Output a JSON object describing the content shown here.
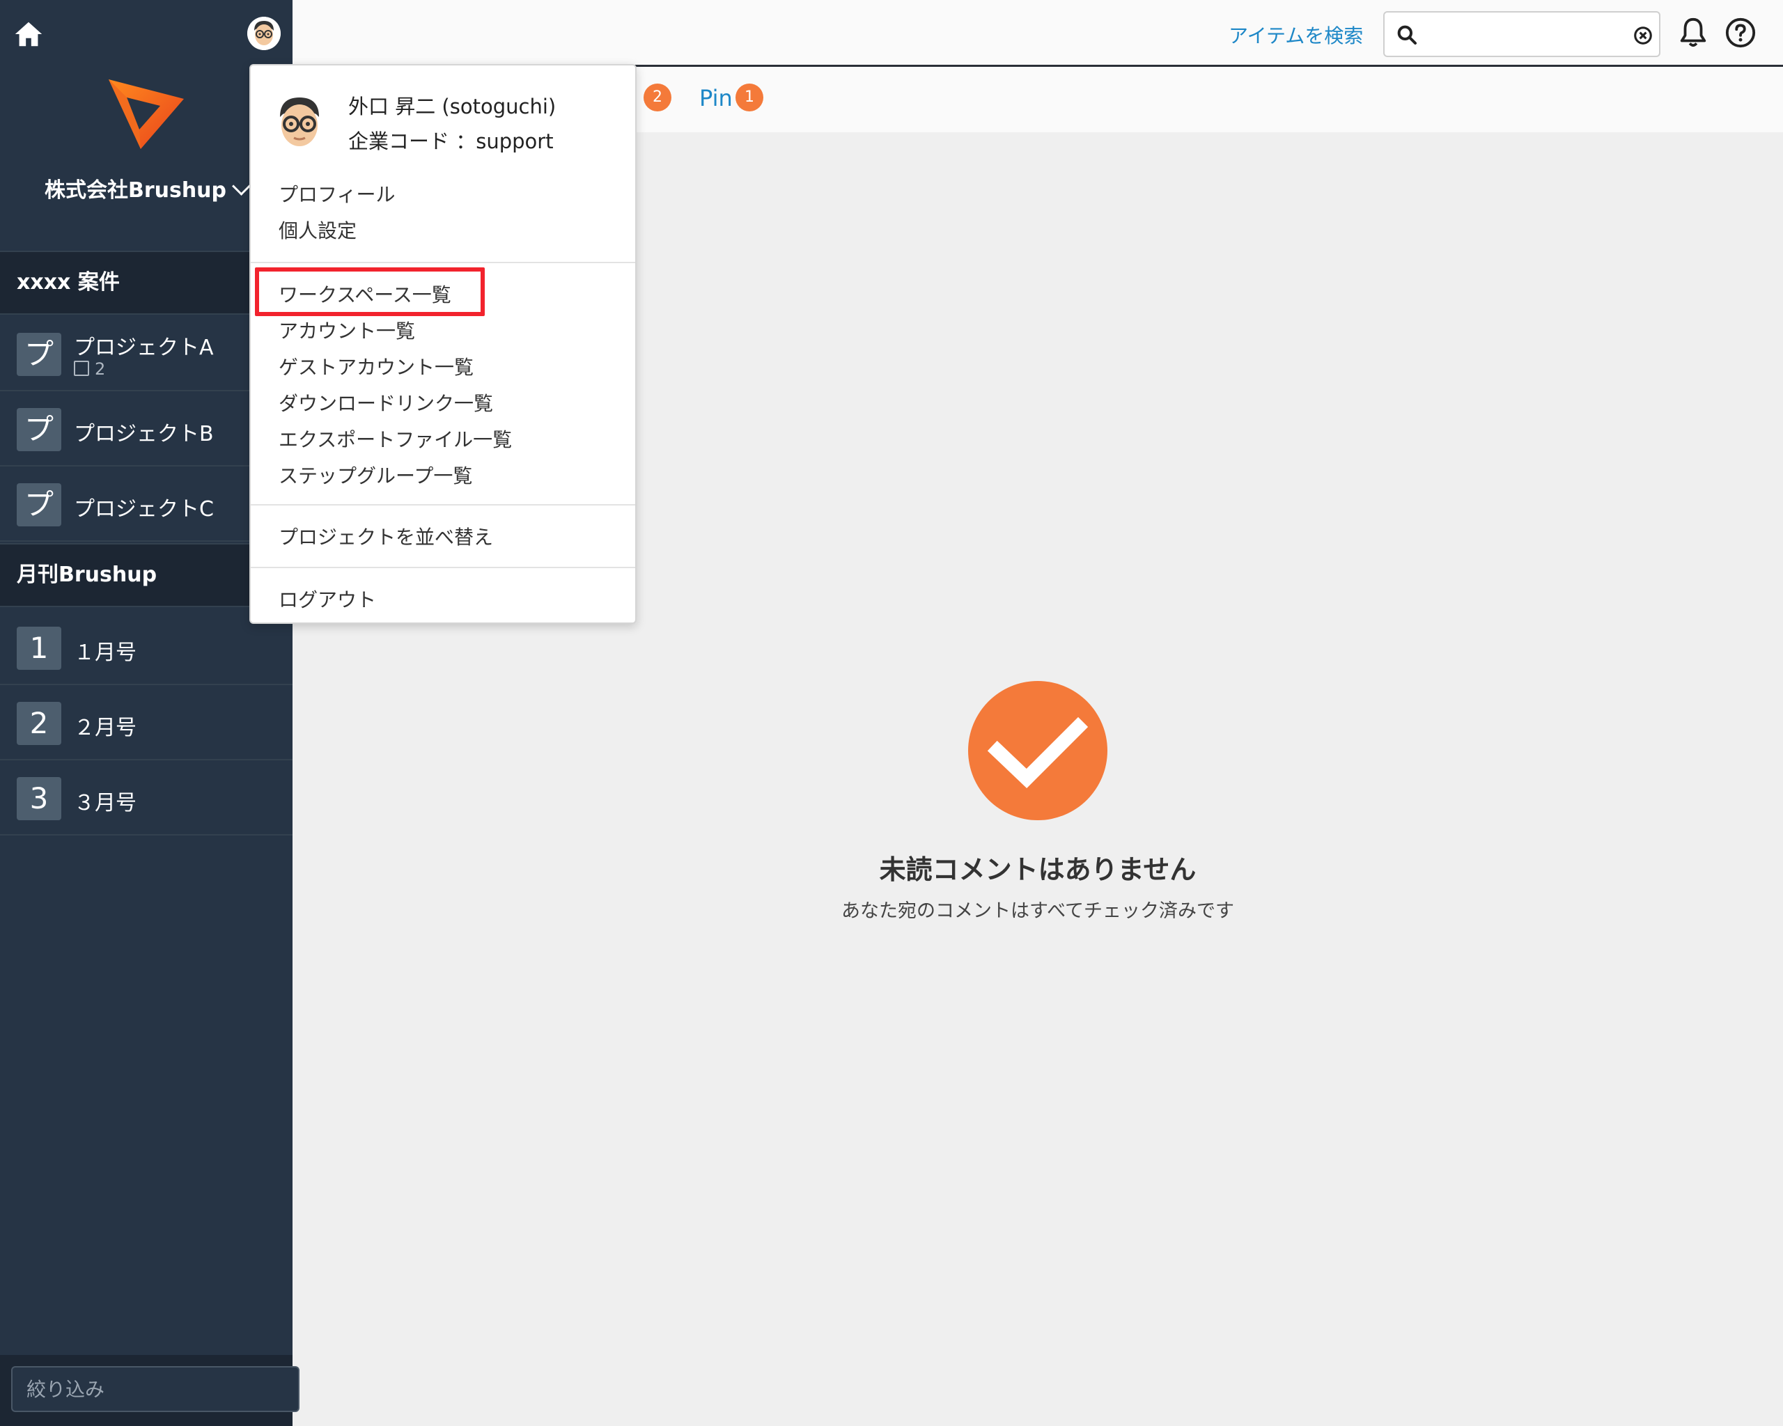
{
  "sidebar": {
    "company": "株式会社Brushup",
    "groups": [
      {
        "title": "xxxx 案件",
        "items": [
          {
            "badge": "プ",
            "label": "プロジェクトA",
            "sub": "2"
          },
          {
            "badge": "プ",
            "label": "プロジェクトB"
          },
          {
            "badge": "プ",
            "label": "プロジェクトC"
          }
        ]
      },
      {
        "title": "月刊Brushup",
        "items": [
          {
            "badge": "1",
            "label": "１月号"
          },
          {
            "badge": "2",
            "label": "２月号"
          },
          {
            "badge": "3",
            "label": "３月号"
          }
        ]
      }
    ],
    "filter_placeholder": "絞り込み"
  },
  "header": {
    "search_link": "アイテムを検索",
    "search_value": ""
  },
  "tabs": {
    "hidden_tab_count": "2",
    "pin_label": "Pin",
    "pin_count": "1"
  },
  "main": {
    "empty_title": "未読コメントはありません",
    "empty_sub": "あなた宛のコメントはすべてチェック済みです"
  },
  "user_menu": {
    "name": "外口 昇二 (sotoguchi)",
    "company_code": "企業コード ：support",
    "items": [
      "プロフィール",
      "個人設定",
      "ワークスペース一覧",
      "アカウント一覧",
      "ゲストアカウント一覧",
      "ダウンロードリンク一覧",
      "エクスポートファイル一覧",
      "ステップグループ一覧",
      "プロジェクトを並べ替え",
      "ログアウト"
    ],
    "highlighted_item": "ワークスペース一覧"
  },
  "colors": {
    "sidebar_bg": "#263445",
    "accent_orange": "#f47a3a",
    "link_blue": "#1d87c7",
    "highlight_red": "#f2232d"
  },
  "icons": [
    "home-icon",
    "avatar",
    "brushup-logo",
    "chevron-down-icon",
    "search-icon",
    "clear-icon",
    "bell-icon",
    "help-icon",
    "checkmark-icon",
    "checkbox-icon"
  ]
}
